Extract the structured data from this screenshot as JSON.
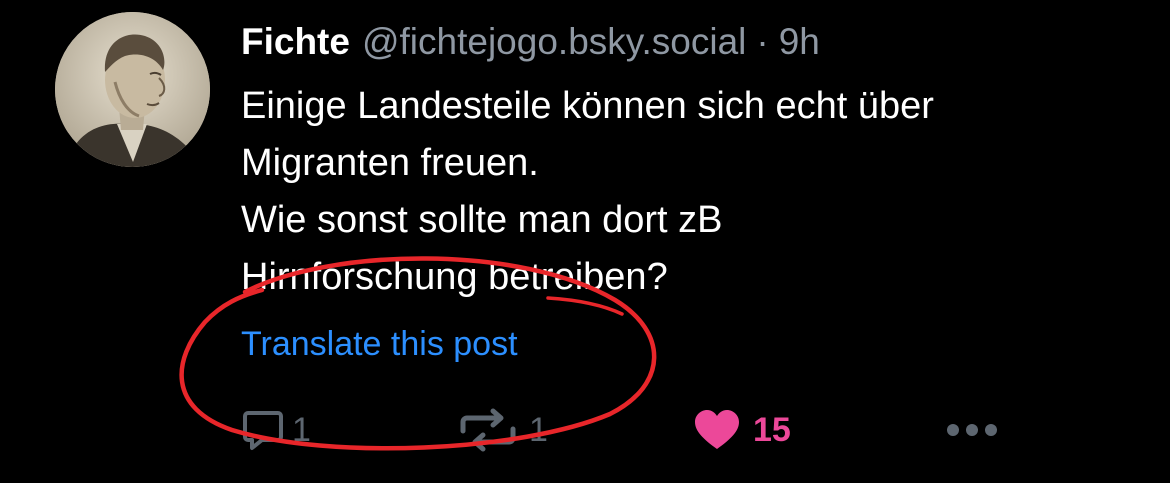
{
  "post": {
    "author": {
      "display_name": "Fichte",
      "handle": "@fichtejogo.bsky.social",
      "avatar_icon": "portrait-avatar"
    },
    "separator": "·",
    "timestamp": "9h",
    "text_lines": [
      "Einige Landesteile können sich echt über",
      "Migranten freuen.",
      "Wie sonst sollte man dort zB",
      "Hirnforschung betreiben?"
    ],
    "translate_label": "Translate this post",
    "actions": {
      "reply": {
        "icon": "reply-icon",
        "count": "1"
      },
      "repost": {
        "icon": "repost-icon",
        "count": "1"
      },
      "like": {
        "icon": "heart-icon",
        "count": "15",
        "active": true
      },
      "more": {
        "icon": "more-icon"
      }
    }
  },
  "colors": {
    "background": "#000000",
    "text": "#ffffff",
    "muted": "#8f98a3",
    "link": "#2c8fff",
    "like": "#ec4899",
    "annotation": "#e8262a"
  }
}
